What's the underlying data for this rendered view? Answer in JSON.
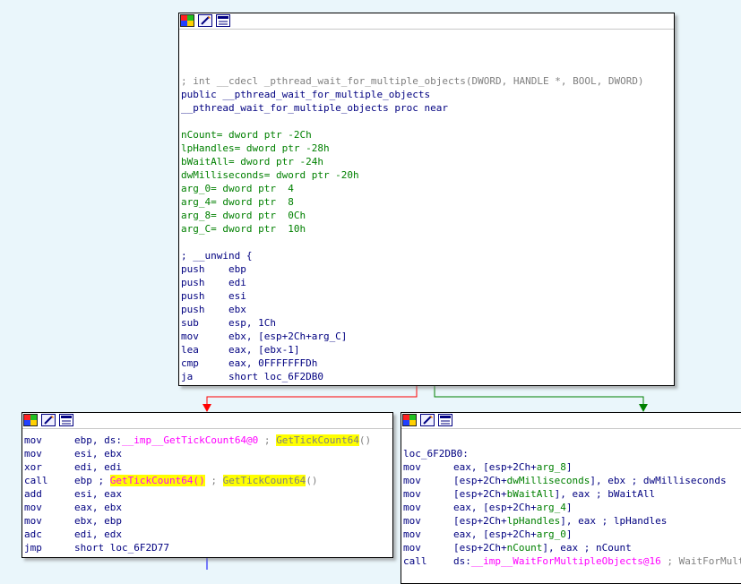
{
  "colors": {
    "background": "#eaf6fb",
    "false_edge": "#ff0000",
    "true_edge": "#008000",
    "flow_edge": "#0000ff",
    "highlight": "#ffff00",
    "code_blue": "#000080",
    "comment_gray": "#808080",
    "stack_var_green": "#008000",
    "import_magenta": "#ff00ff"
  },
  "icons": [
    "color-palette-icon",
    "rename-pencil-icon",
    "graph-view-icon"
  ],
  "top_block": {
    "lines": [
      "",
      "",
      "",
      "; int __cdecl _pthread_wait_for_multiple_objects(DWORD, HANDLE *, BOOL, DWORD)",
      "public __pthread_wait_for_multiple_objects",
      "__pthread_wait_for_multiple_objects proc near",
      "",
      "nCount= dword ptr -2Ch",
      "lpHandles= dword ptr -28h",
      "bWaitAll= dword ptr -24h",
      "dwMilliseconds= dword ptr -20h",
      "arg_0= dword ptr  4",
      "arg_4= dword ptr  8",
      "arg_8= dword ptr  0Ch",
      "arg_C= dword ptr  10h",
      "",
      "; __unwind {",
      "push    ebp",
      "push    edi",
      "push    esi",
      "push    ebx",
      "sub     esp, 1Ch",
      "mov     ebx, [esp+2Ch+arg_C]",
      "lea     eax, [ebx-1]",
      "cmp     eax, 0FFFFFFFDh",
      "ja      short loc_6F2DB0"
    ]
  },
  "left_block": {
    "l1": {
      "mn": "mov",
      "a": "ebp, ds:",
      "b": "__imp__GetTickCount64@0",
      "c": " ; ",
      "d": "GetTickCount64",
      "e": "()"
    },
    "l2": {
      "mn": "mov",
      "ops": "esi, ebx"
    },
    "l3": {
      "mn": "xor",
      "ops": "edi, edi"
    },
    "l4": {
      "mn": "call",
      "a": "ebp ; ",
      "b": "GetTickCount64()",
      "c": " ; ",
      "d": "GetTickCount64",
      "e": "()"
    },
    "l5": {
      "mn": "add",
      "ops": "esi, eax"
    },
    "l6": {
      "mn": "mov",
      "ops": "eax, ebx"
    },
    "l7": {
      "mn": "mov",
      "ops": "ebx, ebp"
    },
    "l8": {
      "mn": "adc",
      "ops": "edi, edx"
    },
    "l9": {
      "mn": "jmp",
      "ops": "short loc_6F2D77"
    }
  },
  "right_block": {
    "label": "loc_6F2DB0:",
    "r1": {
      "mn": "mov",
      "a": "eax, [esp+2Ch+",
      "b": "arg_8",
      "c": "]"
    },
    "r2": {
      "mn": "mov",
      "a": "[esp+2Ch+",
      "b": "dwMilliseconds",
      "c": "], ebx ; dwMilliseconds"
    },
    "r3": {
      "mn": "mov",
      "a": "[esp+2Ch+",
      "b": "bWaitAll",
      "c": "], eax ; bWaitAll"
    },
    "r4": {
      "mn": "mov",
      "a": "eax, [esp+2Ch+",
      "b": "arg_4",
      "c": "]"
    },
    "r5": {
      "mn": "mov",
      "a": "[esp+2Ch+",
      "b": "lpHandles",
      "c": "], eax ; lpHandles"
    },
    "r6": {
      "mn": "mov",
      "a": "eax, [esp+2Ch+",
      "b": "arg_0",
      "c": "]"
    },
    "r7": {
      "mn": "mov",
      "a": "[esp+2Ch+",
      "b": "nCount",
      "c": "], eax ; nCount"
    },
    "r8": {
      "mn": "call",
      "a": "ds:",
      "b": "__imp__WaitForMultipleObjects@16",
      "c": " ; WaitForMultipleObjects"
    }
  }
}
